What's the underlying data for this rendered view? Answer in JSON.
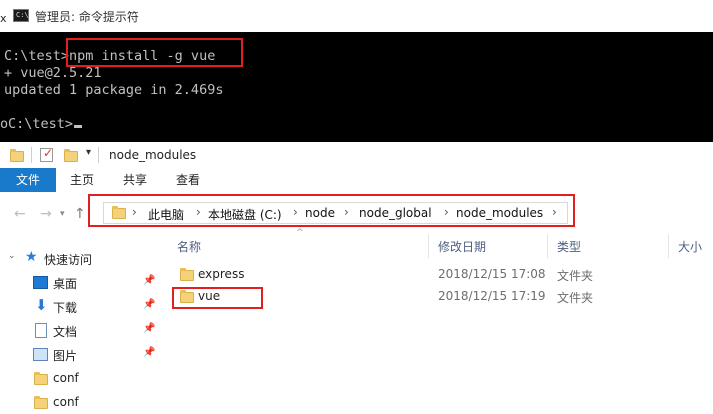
{
  "cmd": {
    "title": "管理员: 命令提示符",
    "app_icon_text": "C:\\",
    "edge_char": "x",
    "lines": [
      "C:\\test>npm install -g vue",
      "+ vue@2.5.21",
      "updated 1 package in 2.469s",
      "",
      "C:\\test>"
    ],
    "edge_prefix": "o"
  },
  "explorer": {
    "window_title": "node_modules",
    "ribbon_tabs": [
      "文件",
      "主页",
      "共享",
      "查看"
    ],
    "address": {
      "crumbs": [
        "此电脑",
        "本地磁盘 (C:)",
        "node",
        "node_global",
        "node_modules"
      ]
    },
    "nav_pane": {
      "quick_access": "快速访问",
      "items": [
        {
          "label": "桌面",
          "icon": "desktop-icon",
          "pinned": true
        },
        {
          "label": "下载",
          "icon": "download-icon",
          "pinned": true
        },
        {
          "label": "文档",
          "icon": "document-icon",
          "pinned": true
        },
        {
          "label": "图片",
          "icon": "picture-icon",
          "pinned": true
        },
        {
          "label": "conf",
          "icon": "folder-icon",
          "pinned": false
        },
        {
          "label": "conf",
          "icon": "folder-icon",
          "pinned": false
        }
      ]
    },
    "columns": [
      "名称",
      "修改日期",
      "类型",
      "大小"
    ],
    "files": [
      {
        "name": "express",
        "modified": "2018/12/15 17:08",
        "type": "文件夹"
      },
      {
        "name": "vue",
        "modified": "2018/12/15 17:19",
        "type": "文件夹"
      }
    ]
  },
  "colors": {
    "highlight_box": "#e02020",
    "file_tab": "#1979ca",
    "console_bg": "#000000",
    "console_text": "#c0c0c0"
  }
}
